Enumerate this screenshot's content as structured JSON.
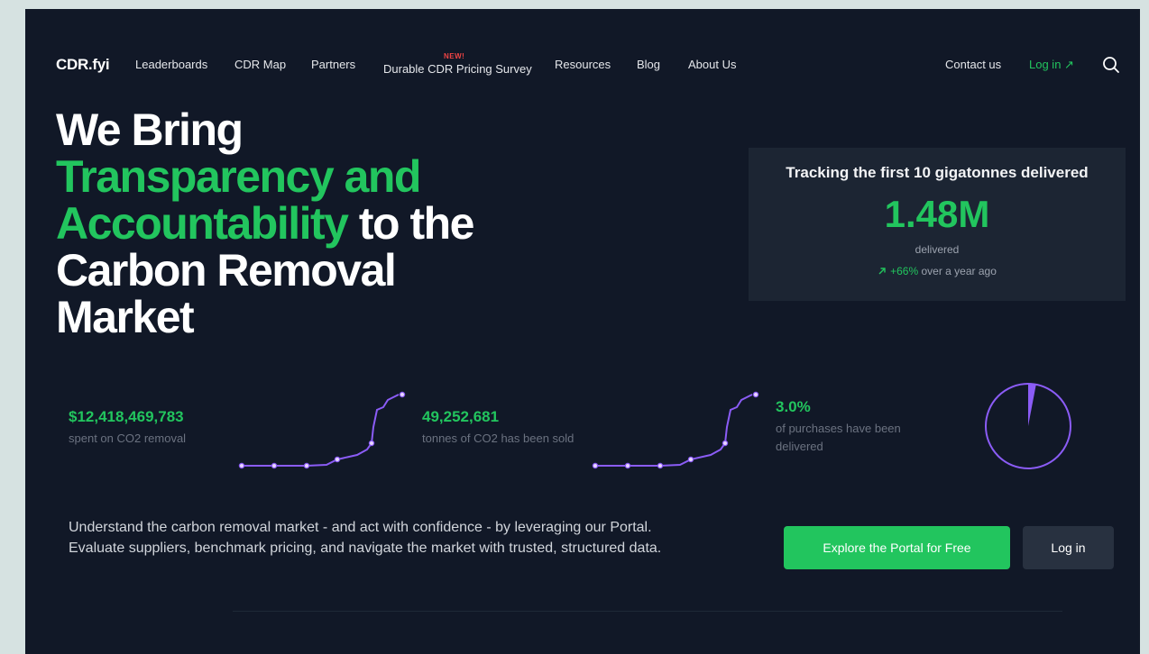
{
  "nav": {
    "logo": "CDR.fyi",
    "items": [
      "Leaderboards",
      "CDR Map",
      "Partners",
      "Durable CDR Pricing Survey",
      "Resources",
      "Blog",
      "About Us"
    ],
    "new_badge": "NEW!",
    "contact": "Contact us",
    "login": "Log in ↗",
    "search_icon": "search-icon"
  },
  "hero": {
    "line1": "We Bring",
    "highlight_1": "Transparency and",
    "highlight_2": "Accountability",
    "line3_rest": " to the",
    "line4": "Carbon Removal",
    "line5": "Market"
  },
  "tracking": {
    "title": "Tracking the first 10 gigatonnes delivered",
    "value": "1.48M",
    "sub": "delivered",
    "growth_value": "+66%",
    "growth_text": " over a year ago",
    "growth_icon": "arrow-up-right-icon"
  },
  "stats": [
    {
      "value": "$12,418,469,783",
      "label": "spent on CO2 removal"
    },
    {
      "value": "49,252,681",
      "label": "tonnes of CO2 has been sold"
    },
    {
      "value": "3.0%",
      "label_1": "of purchases have been",
      "label_2": "delivered"
    }
  ],
  "delivered_fraction": 0.03,
  "description": "Understand the carbon removal market - and act with confidence - by leveraging our Portal. Evaluate suppliers, benchmark pricing, and navigate the market with trusted, structured data.",
  "cta": {
    "primary": "Explore the Portal for Free",
    "secondary": "Log in"
  },
  "colors": {
    "background": "#111827",
    "accent": "#22c55e",
    "chart": "#8b5cf6"
  }
}
